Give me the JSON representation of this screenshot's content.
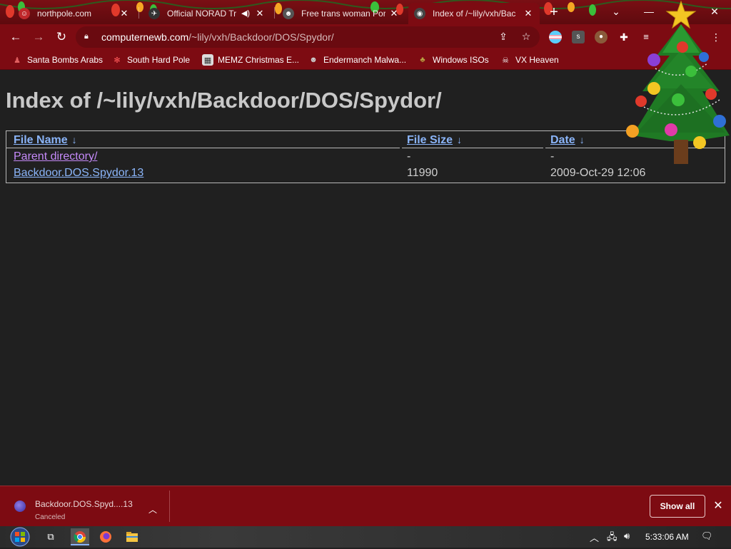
{
  "tabs": [
    {
      "title": "northpole.com",
      "icon": "santa-favicon-icon",
      "active": false
    },
    {
      "title": "Official NORAD Tr",
      "icon": "norad-favicon-icon",
      "active": false,
      "audio": "speaker-icon"
    },
    {
      "title": "Free trans woman Porn",
      "icon": "raccoon-favicon-icon",
      "active": false
    },
    {
      "title": "Index of /~lily/vxh/Bac",
      "icon": "globe-favicon-icon",
      "active": true
    }
  ],
  "window_controls": {
    "tab_search": "⌄",
    "minimize": "—",
    "maximize": "☐",
    "close": "✕"
  },
  "address": {
    "host": "computernewb.com",
    "path": "/~lily/vxh/Backdoor/DOS/Spydor/"
  },
  "bookmarks": [
    {
      "label": "Santa Bombs Arabs",
      "icon": "santa-icon"
    },
    {
      "label": "South Hard Pole",
      "icon": "snowflake-icon"
    },
    {
      "label": "MEMZ Christmas E...",
      "icon": "memz-icon"
    },
    {
      "label": "Endermanch Malwa...",
      "icon": "raccoon-icon"
    },
    {
      "label": "Windows ISOs",
      "icon": "tree-icon"
    },
    {
      "label": "VX Heaven",
      "icon": "vx-icon"
    }
  ],
  "page": {
    "heading": "Index of /~lily/vxh/Backdoor/DOS/Spydor/",
    "columns": [
      "File Name",
      "File Size",
      "Date"
    ],
    "sort_arrow": "↓",
    "rows": [
      {
        "name": "Parent directory/",
        "size": "-",
        "date": "-"
      },
      {
        "name": "Backdoor.DOS.Spydor.13",
        "size": "11990",
        "date": "2009-Oct-29 12:06"
      }
    ]
  },
  "download": {
    "filename": "Backdoor.DOS.Spyd....13",
    "status": "Canceled",
    "show_all": "Show all"
  },
  "taskbar": {
    "clock": "5:33:06 AM"
  },
  "colors": {
    "chrome_theme": "#7d0b12",
    "link": "#8ab4f8",
    "visited_link": "#c58af9",
    "page_bg": "#202020"
  }
}
